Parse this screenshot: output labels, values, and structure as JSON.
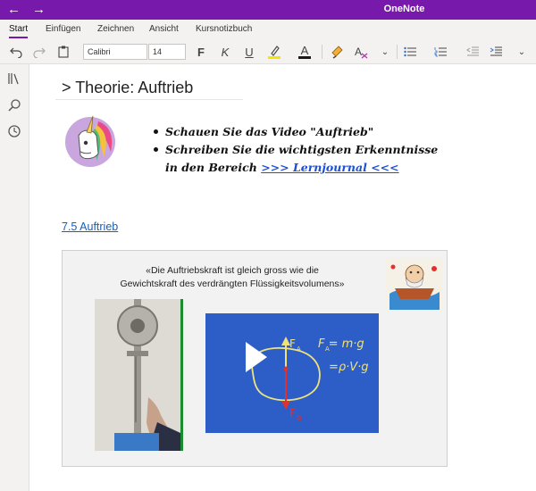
{
  "app": {
    "title": "OneNote"
  },
  "tabs": [
    "Start",
    "Einfügen",
    "Zeichnen",
    "Ansicht",
    "Kursnotizbuch"
  ],
  "ribbon": {
    "font_name": "Calibri",
    "font_size": "14",
    "bold_label": "F",
    "italic_label": "K",
    "underline_label": "U",
    "font_color_label": "A",
    "highlight_color": "#f2e600",
    "font_color": "#1a1a1a"
  },
  "page": {
    "title": "> Theorie: Auftrieb",
    "bullets": {
      "line1": "Schauen Sie das Video \"Auftrieb\"",
      "line2": "Schreiben Sie die wichtigsten Erkenntnisse",
      "line3_prefix": "in den Bereich ",
      "line3_link": ">>> Lernjournal <<<"
    },
    "section_link": "7.5 Auftrieb",
    "video": {
      "quote_line1": "«Die Auftriebskraft ist gleich gross wie die",
      "quote_line2": "Gewichtskraft des verdrängten Flüssigkeitsvolumens»",
      "board_fa": "F",
      "board_fa_sub": "A",
      "board_fg": "F",
      "board_fg_sub": "G",
      "formula1": "F   = m·g",
      "formula1_sub": "A",
      "formula2": "=ρ·V·g"
    }
  },
  "colors": {
    "accent": "#7719aa",
    "link": "#1a5fb4"
  }
}
